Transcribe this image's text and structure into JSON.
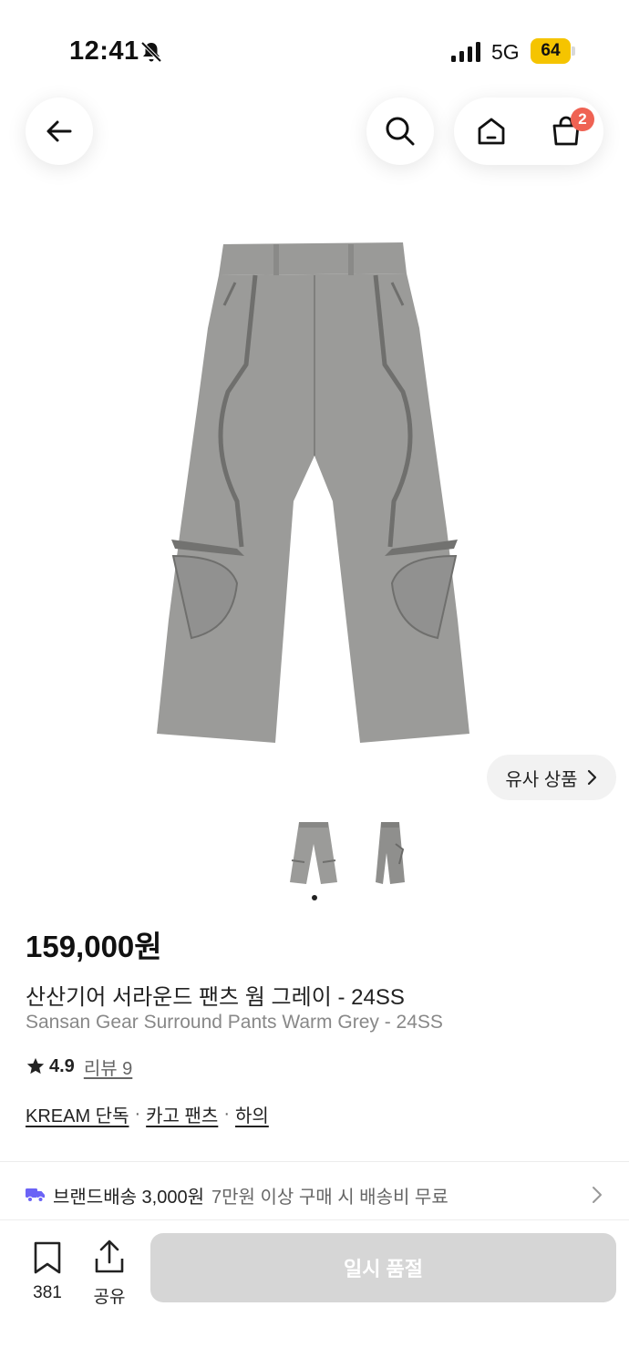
{
  "status_bar": {
    "time": "12:41",
    "network": "5G",
    "battery": "64",
    "battery_color": "#f5c400"
  },
  "header": {
    "back_icon": "arrow-left-icon",
    "search_icon": "search-icon",
    "home_icon": "home-icon",
    "bag_icon": "shopping-bag-icon",
    "cart_badge": "2",
    "badge_color": "#ef6253"
  },
  "gallery": {
    "similar_button": "유사 상품",
    "image_count": 2,
    "active_index": 0
  },
  "product": {
    "price": "159,000원",
    "title_ko": "산산기어 서라운드 팬츠 웜 그레이 - 24SS",
    "title_en": "Sansan Gear Surround Pants Warm Grey - 24SS",
    "rating": "4.9",
    "reviews_label": "리뷰 9",
    "tags": [
      "KREAM 단독",
      "카고 팬츠",
      "하의"
    ]
  },
  "shipping": {
    "label": "브랜드배송 3,000원",
    "note": "7만원 이상 구매 시 배송비 무료",
    "icon": "truck-icon",
    "icon_color": "#6b63f6"
  },
  "bottom_bar": {
    "bookmark_count": "381",
    "share_label": "공유",
    "buy_button": "일시 품절",
    "buy_button_color": "#d6d6d6"
  }
}
